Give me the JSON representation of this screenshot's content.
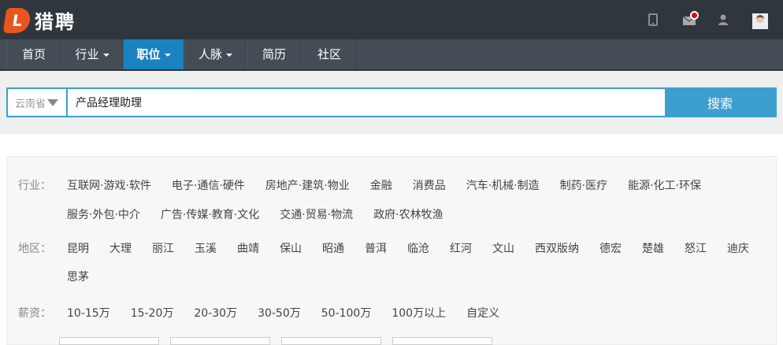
{
  "logo": {
    "mark": "L",
    "text": "猎聘"
  },
  "header_icons": [
    "tablet-icon",
    "mail-icon",
    "contacts-icon",
    "avatar"
  ],
  "nav": [
    {
      "label": "首页",
      "dropdown": false
    },
    {
      "label": "行业",
      "dropdown": true
    },
    {
      "label": "职位",
      "dropdown": true,
      "active": true
    },
    {
      "label": "人脉",
      "dropdown": true
    },
    {
      "label": "简历",
      "dropdown": false
    },
    {
      "label": "社区",
      "dropdown": false
    }
  ],
  "search": {
    "region": "云南省",
    "query": "产品经理助理",
    "button": "搜索"
  },
  "filters": {
    "industry": {
      "label": "行业：",
      "row1": [
        "互联网·游戏·软件",
        "电子·通信·硬件",
        "房地产·建筑·物业",
        "金融",
        "消费品",
        "汽车·机械·制造",
        "制药·医疗",
        "能源·化工·环保"
      ],
      "row2": [
        "服务·外包·中介",
        "广告·传媒·教育·文化",
        "交通·贸易·物流",
        "政府·农林牧渔"
      ]
    },
    "region": {
      "label": "地区：",
      "row1": [
        "昆明",
        "大理",
        "丽江",
        "玉溪",
        "曲靖",
        "保山",
        "昭通",
        "普洱",
        "临沧",
        "红河",
        "文山",
        "西双版纳",
        "德宏",
        "楚雄",
        "怒江",
        "迪庆"
      ],
      "row2": [
        "思茅"
      ]
    },
    "salary": {
      "label": "薪资：",
      "row1": [
        "10-15万",
        "15-20万",
        "20-30万",
        "30-50万",
        "50-100万",
        "100万以上",
        "自定义"
      ]
    }
  },
  "colors": {
    "header": "#30363d",
    "nav": "#444d55",
    "accent": "#1a82c1",
    "search": "#3d9fd0",
    "logo": "#e8551e"
  }
}
